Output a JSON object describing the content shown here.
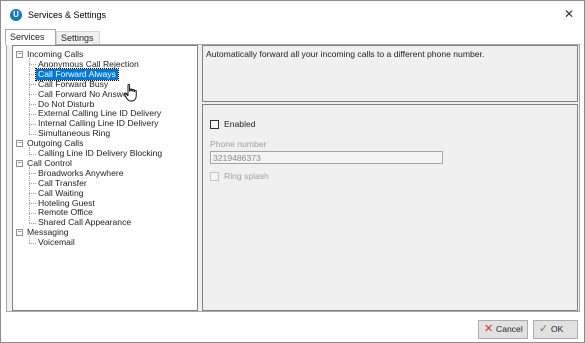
{
  "window": {
    "title": "Services & Settings",
    "app_icon": "U",
    "close_glyph": "✕"
  },
  "tabs": [
    {
      "label": "Services"
    },
    {
      "label": "Settings"
    }
  ],
  "tree": {
    "groups": [
      {
        "label": "Incoming Calls",
        "expander": "−",
        "items": [
          "Anonymous Call Rejection",
          "Call Forward Always",
          "Call Forward Busy",
          "Call Forward No Answer",
          "Do Not Disturb",
          "External Calling Line ID Delivery",
          "Internal Calling Line ID Delivery",
          "Simultaneous Ring"
        ]
      },
      {
        "label": "Outgoing Calls",
        "expander": "−",
        "items": [
          "Calling Line ID Delivery Blocking"
        ]
      },
      {
        "label": "Call Control",
        "expander": "−",
        "items": [
          "Broadworks Anywhere",
          "Call Transfer",
          "Call Waiting",
          "Hoteling Guest",
          "Remote Office",
          "Shared Call Appearance"
        ]
      },
      {
        "label": "Messaging",
        "expander": "−",
        "items": [
          "Voicemail"
        ]
      }
    ],
    "selected": "Call Forward Always"
  },
  "description": "Automatically forward all your incoming calls to a different phone number.",
  "settings": {
    "enabled_label": "Enabled",
    "enabled_checked": false,
    "phone_label": "Phone number",
    "phone_value": "3219486373",
    "ring_splash_label": "Ring splash",
    "ring_splash_checked": false
  },
  "buttons": {
    "cancel": {
      "label": "Cancel",
      "icon": "close-icon",
      "glyph": "✕",
      "color": "#d2302f"
    },
    "ok": {
      "label": "OK",
      "icon": "check-icon",
      "glyph": "✓",
      "color": "#3c9b3c"
    }
  },
  "colors": {
    "selection": "#0078d7",
    "app_icon": "#1a78c2"
  }
}
